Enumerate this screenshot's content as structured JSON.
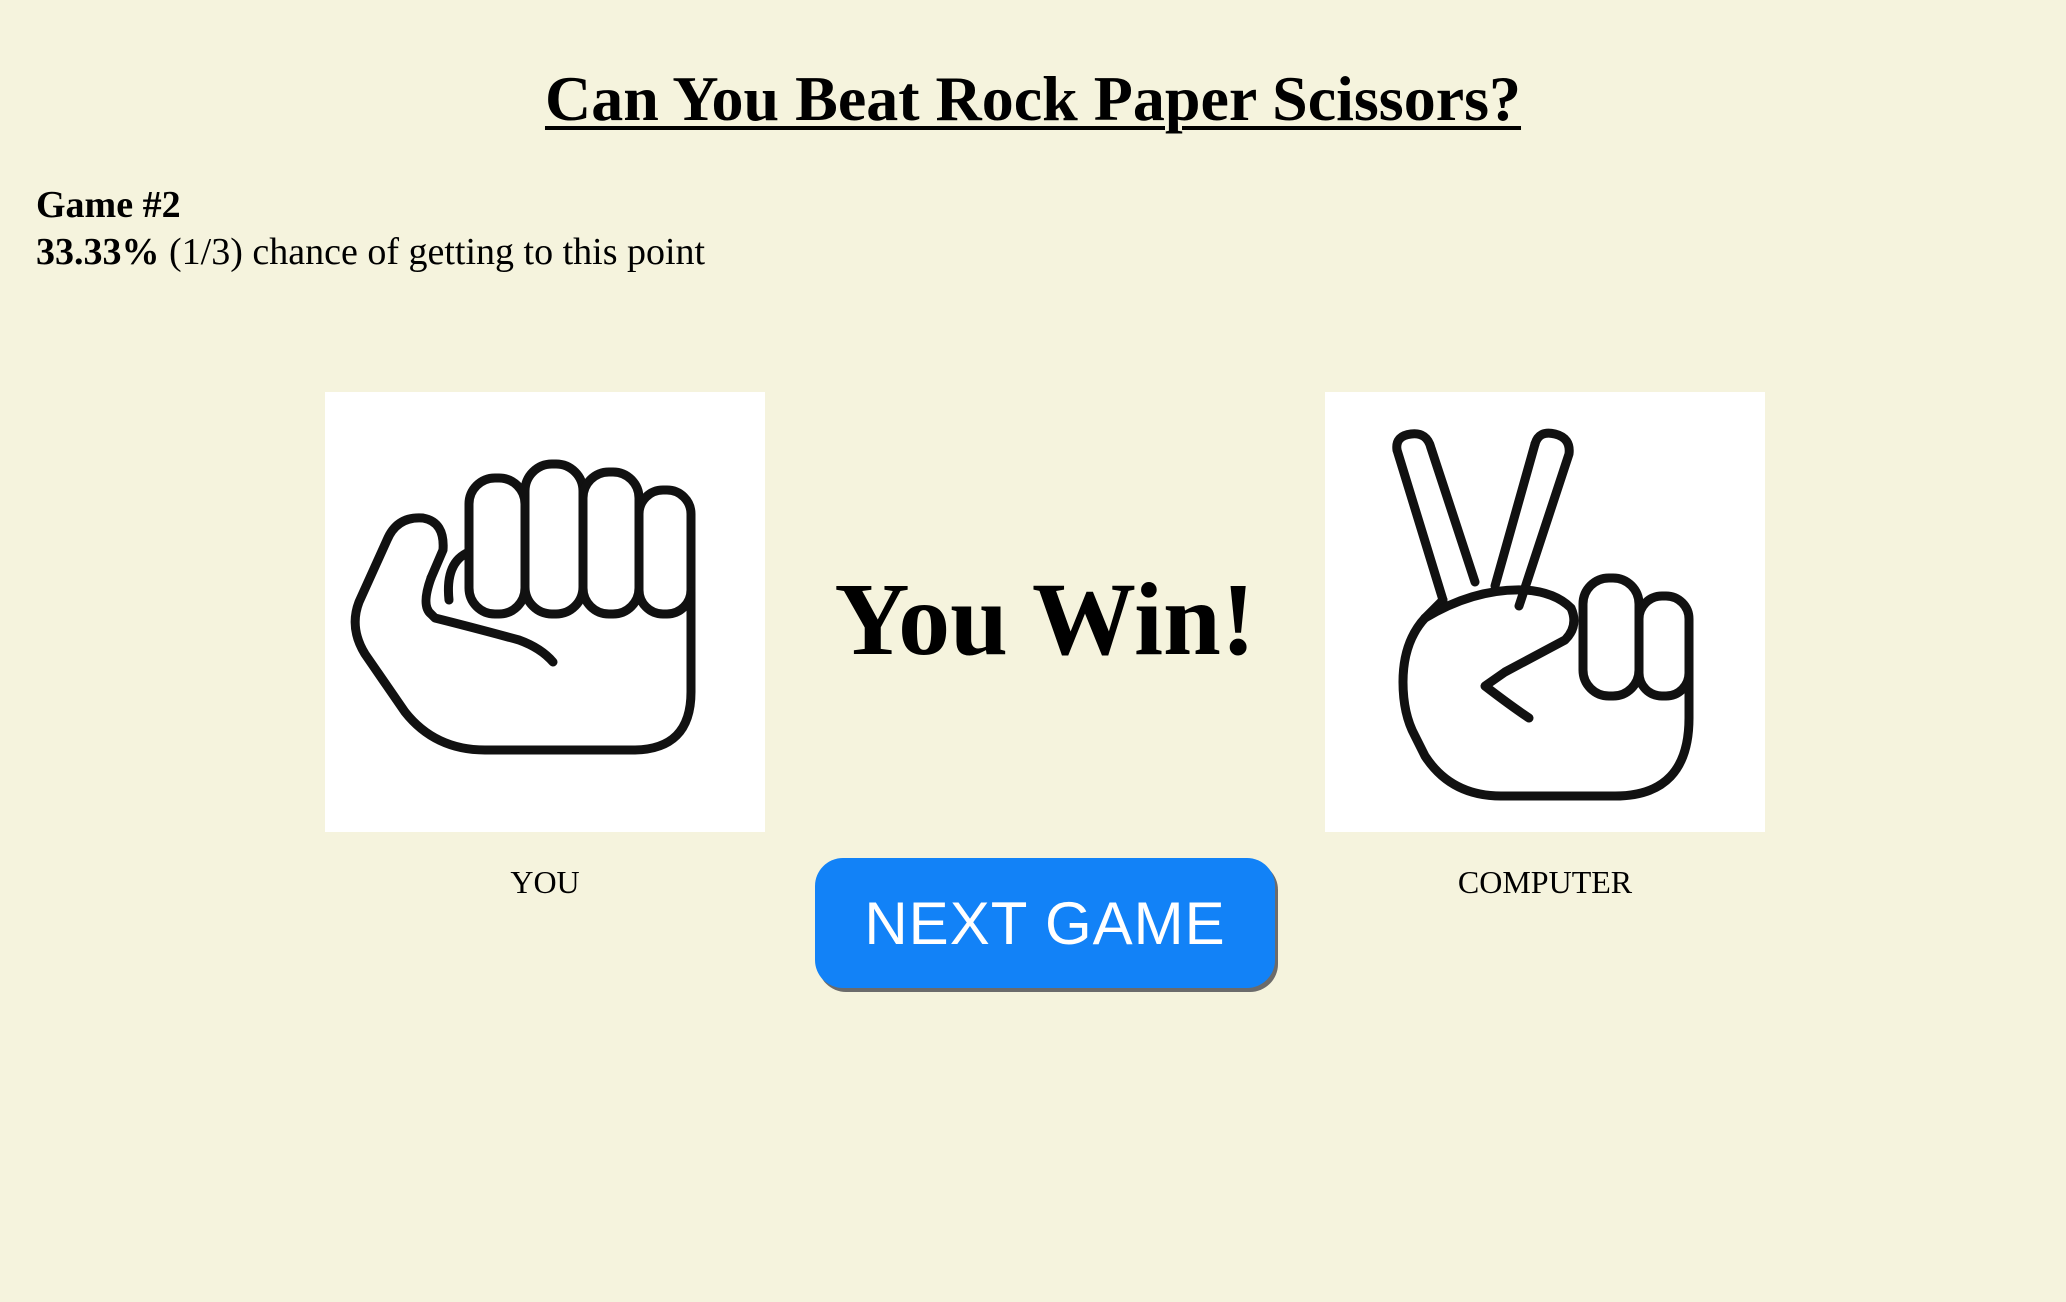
{
  "header": {
    "title": "Can You Beat Rock Paper Scissors?"
  },
  "game": {
    "number_label": "Game #2",
    "chance_percent": "33.33%",
    "chance_fraction": "(1/3)",
    "chance_suffix": "chance of getting to this point"
  },
  "players": {
    "you": {
      "label": "YOU",
      "choice_icon": "rock-fist-icon"
    },
    "computer": {
      "label": "COMPUTER",
      "choice_icon": "scissors-peace-icon"
    }
  },
  "result": {
    "text": "You Win!"
  },
  "actions": {
    "next_game_label": "NEXT GAME"
  },
  "colors": {
    "background": "#f5f3dd",
    "button": "#1282f7",
    "button_text": "#ffffff"
  }
}
